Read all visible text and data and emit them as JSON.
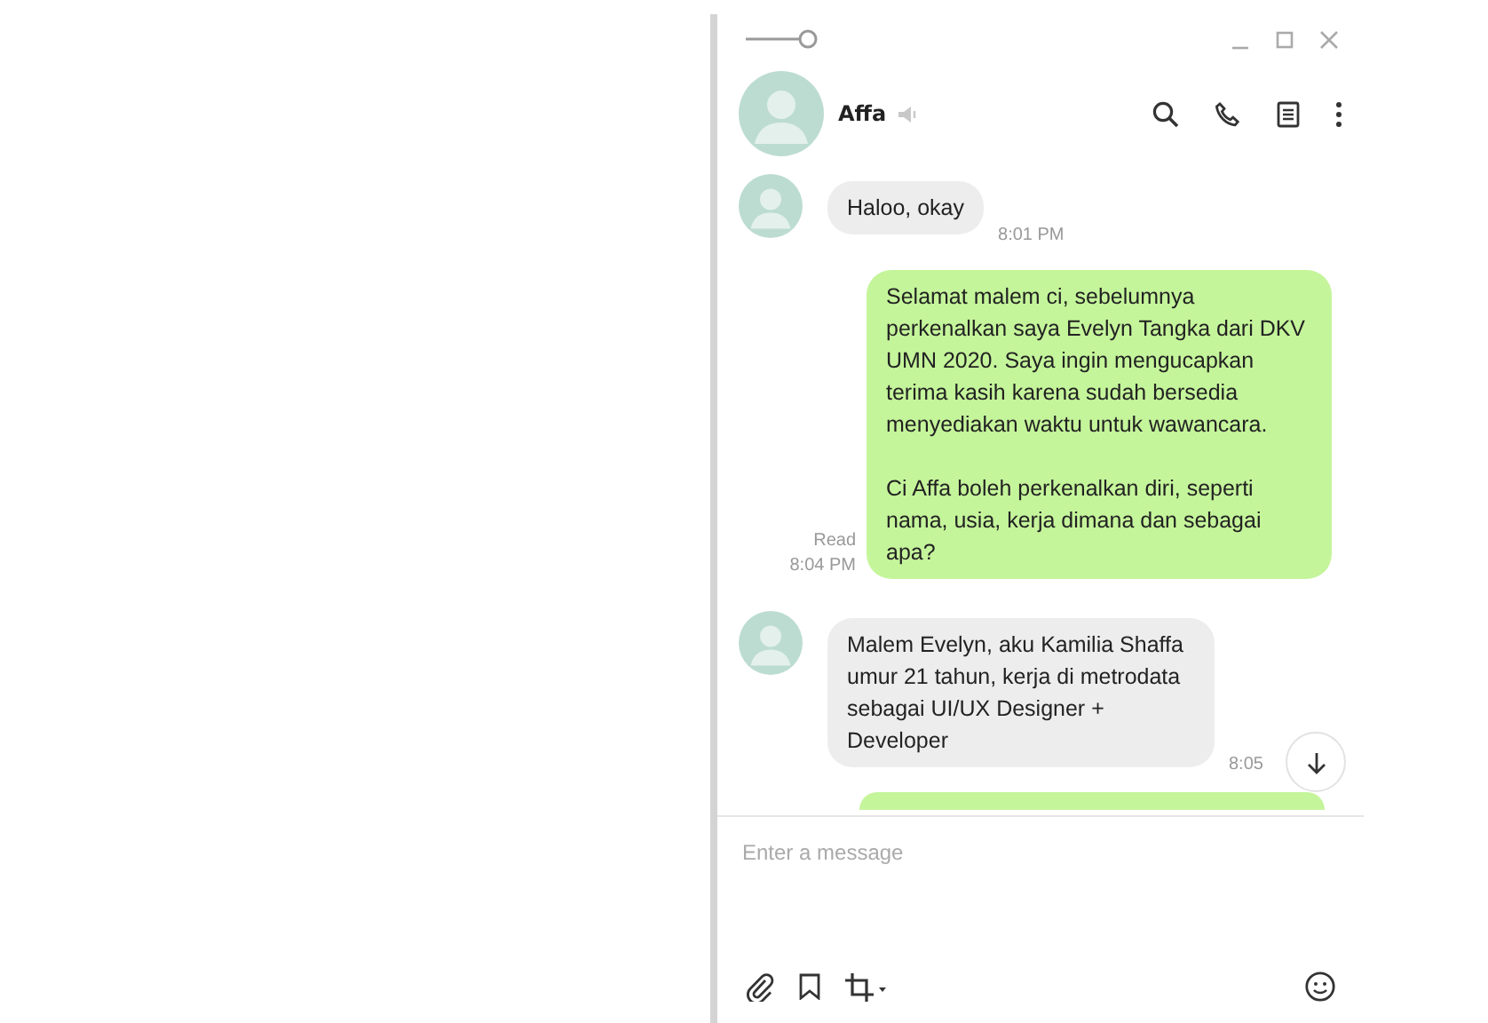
{
  "contact": {
    "name": "Affa"
  },
  "messages": [
    {
      "kind": "received",
      "text": "Haloo, okay",
      "time": "8:01 PM"
    },
    {
      "kind": "sent",
      "text": "Selamat malem ci, sebelumnya perkenalkan saya Evelyn Tangka dari DKV UMN 2020. Saya ingin mengucapkan terima kasih karena sudah bersedia menyediakan waktu untuk wawancara.\n\nCi Affa boleh perkenalkan diri, seperti nama, usia, kerja dimana dan sebagai apa?",
      "status": "Read",
      "time": "8:04 PM"
    },
    {
      "kind": "received",
      "text": "Malem Evelyn, aku Kamilia Shaffa umur 21 tahun, kerja di metrodata sebagai UI/UX Designer + Developer",
      "time": "8:05"
    },
    {
      "kind": "sent_partial"
    }
  ],
  "composer": {
    "placeholder": "Enter a message"
  }
}
